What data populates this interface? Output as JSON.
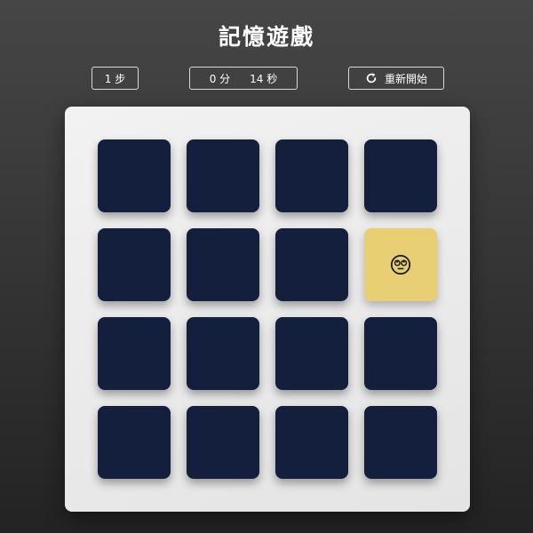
{
  "title": "記憶遊戲",
  "moves": {
    "text": "1 步"
  },
  "timer": {
    "minutes": "0 分",
    "seconds": "14 秒"
  },
  "restart": {
    "label": "重新開始",
    "icon": "restart-icon"
  },
  "colors": {
    "card_back": "#141e3d",
    "card_open": "#e8cf74",
    "board": "#ececec"
  },
  "board": {
    "columns": 4,
    "rows": 4,
    "cards": [
      {
        "state": "hidden"
      },
      {
        "state": "hidden"
      },
      {
        "state": "hidden"
      },
      {
        "state": "hidden"
      },
      {
        "state": "hidden"
      },
      {
        "state": "hidden"
      },
      {
        "state": "hidden"
      },
      {
        "state": "open",
        "icon": "face-eyes-rolling-icon"
      },
      {
        "state": "hidden"
      },
      {
        "state": "hidden"
      },
      {
        "state": "hidden"
      },
      {
        "state": "hidden"
      },
      {
        "state": "hidden"
      },
      {
        "state": "hidden"
      },
      {
        "state": "hidden"
      },
      {
        "state": "hidden"
      }
    ]
  }
}
